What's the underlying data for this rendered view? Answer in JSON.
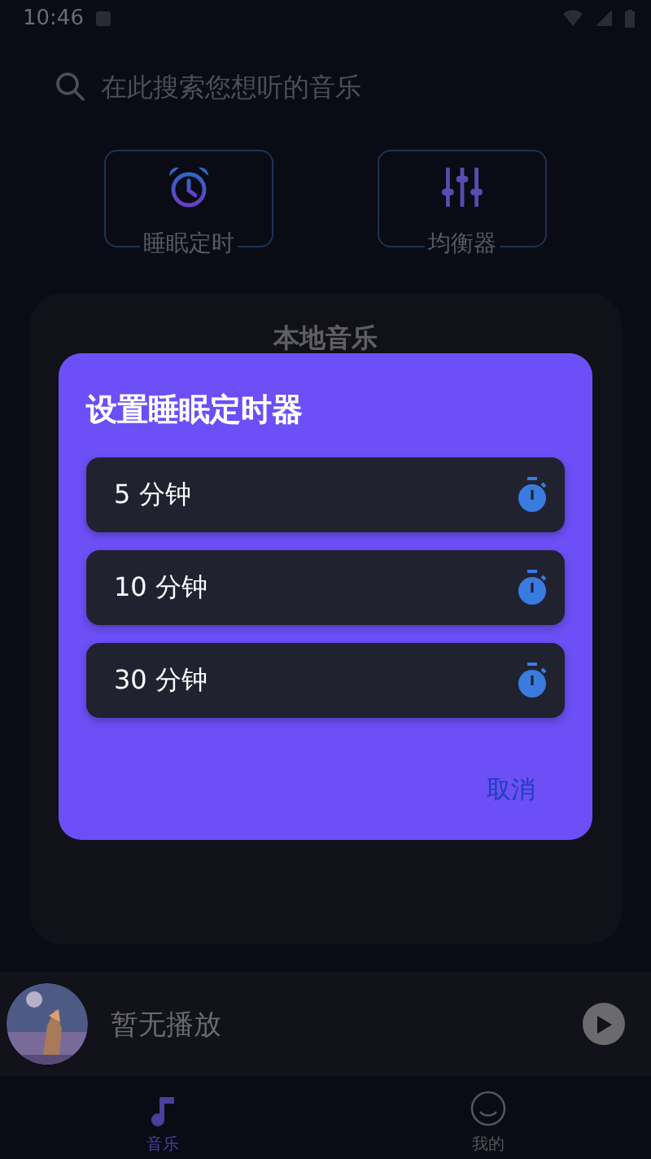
{
  "status_bar": {
    "time": "10:46"
  },
  "search": {
    "placeholder": "在此搜索您想听的音乐"
  },
  "shortcuts": [
    {
      "label": "睡眠定时",
      "kind": "alarm"
    },
    {
      "label": "均衡器",
      "kind": "equalizer"
    }
  ],
  "section": {
    "title": "本地音乐"
  },
  "dialog": {
    "title": "设置睡眠定时器",
    "options": [
      {
        "label": "5 分钟"
      },
      {
        "label": "10 分钟"
      },
      {
        "label": "30 分钟"
      }
    ],
    "cancel": "取消"
  },
  "player": {
    "title": "暂无播放"
  },
  "nav": [
    {
      "label": "音乐",
      "selected": true,
      "kind": "music"
    },
    {
      "label": "我的",
      "selected": false,
      "kind": "profile"
    }
  ]
}
